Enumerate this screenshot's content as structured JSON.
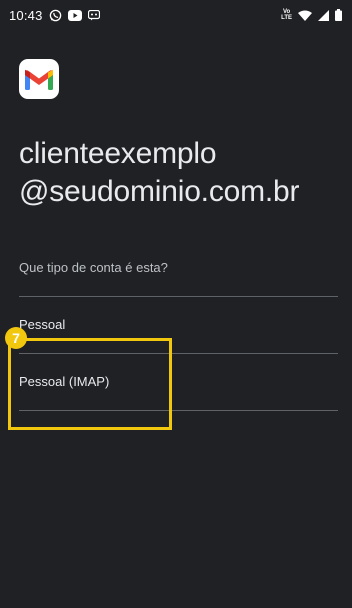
{
  "status_bar": {
    "time": "10:43",
    "volte_label_1": "Vo",
    "volte_label_2": "LTE",
    "icons_left": [
      "whatsapp-icon",
      "youtube-icon",
      "assistant-icon"
    ],
    "icons_right": [
      "volte-icon",
      "wifi-icon",
      "cell-signal-icon",
      "battery-icon"
    ]
  },
  "app": {
    "logo": "gmail-icon"
  },
  "account": {
    "email_line_1": "clienteexemplo",
    "email_line_2": "@seudominio.com.br"
  },
  "question": "Que tipo de conta é esta?",
  "options": [
    {
      "label": "Pessoal"
    },
    {
      "label": "Pessoal (IMAP)"
    }
  ],
  "annotation": {
    "step_number": "7",
    "highlight_color": "#f2c80f"
  },
  "colors": {
    "background": "#202124",
    "text": "#e8eaed",
    "secondary_text": "#bdc1c6",
    "divider": "#5f6368"
  }
}
